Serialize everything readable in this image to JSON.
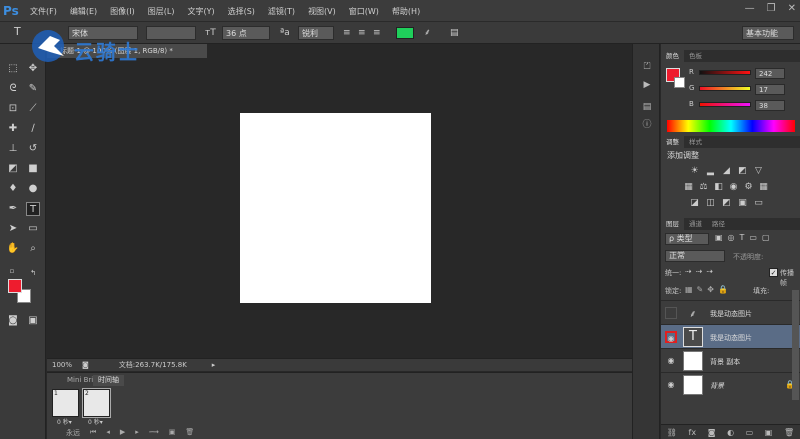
{
  "app": {
    "logo": "Ps"
  },
  "menu": [
    "文件(F)",
    "编辑(E)",
    "图像(I)",
    "图层(L)",
    "文字(Y)",
    "选择(S)",
    "滤镜(T)",
    "视图(V)",
    "窗口(W)",
    "帮助(H)"
  ],
  "window_controls": {
    "minimize": "—",
    "restore": "❐",
    "close": "✕"
  },
  "options": {
    "font_family": "宋体",
    "font_size": "36 点",
    "antialias": "锐利",
    "color_swatch": "#1fcf5b",
    "workspace": "基本功能"
  },
  "watermark": "云骑士",
  "document": {
    "tab_title": "未标题-1 @ 100% (图层 1, RGB/8) *"
  },
  "status": {
    "zoom": "100%",
    "doc_info": "文档:263.7K/175.8K"
  },
  "timeline": {
    "tabs": [
      "Mini Bridge",
      "时间轴"
    ],
    "frames": [
      {
        "num": "1",
        "delay": "0 秒▾"
      },
      {
        "num": "2",
        "delay": "0 秒▾"
      }
    ],
    "loop": "永远"
  },
  "color_panel": {
    "tabs": [
      "颜色",
      "色板"
    ],
    "foreground": "#ee1c2e",
    "r_label": "R",
    "r_value": "242",
    "g_label": "G",
    "g_value": "17",
    "b_label": "B",
    "b_value": "38"
  },
  "adjust_panel": {
    "tabs": [
      "调整",
      "样式"
    ],
    "title": "添加调整"
  },
  "layers_panel": {
    "tabs": [
      "图层",
      "通道",
      "路径"
    ],
    "filter": "ρ 类型",
    "blend_mode": "正常",
    "opacity_label": "不透明度:",
    "unify_label": "统一:",
    "propagate_label": "传播帧",
    "lock_label": "锁定:",
    "fill_label": "填充:",
    "layers": [
      {
        "name": "我是动态图片",
        "kind": "text-placeholder"
      },
      {
        "name": "我是动态图片",
        "kind": "text",
        "selected": true
      },
      {
        "name": "背景 副本",
        "kind": "image"
      },
      {
        "name": "背景",
        "kind": "image",
        "locked": true
      }
    ]
  }
}
